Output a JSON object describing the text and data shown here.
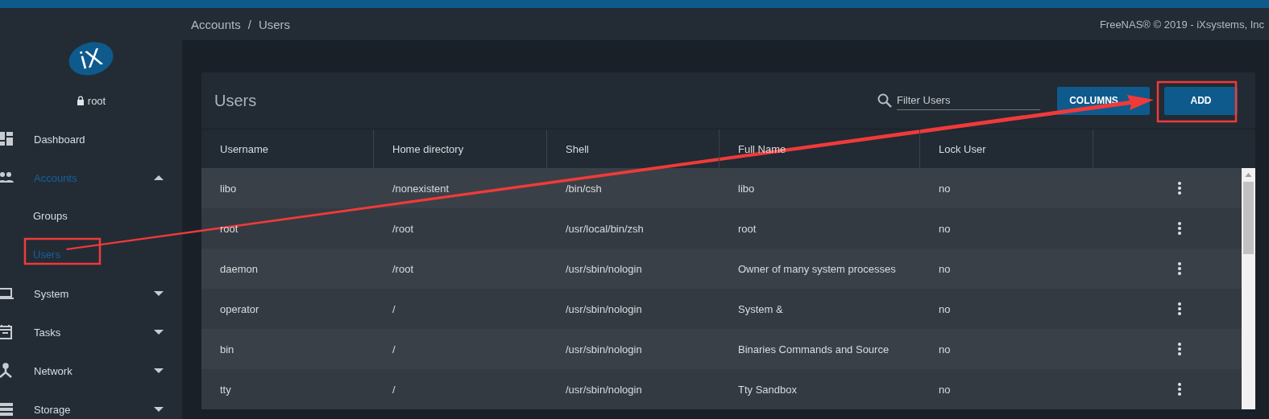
{
  "logo": {
    "text": "iX"
  },
  "user": {
    "name": "root"
  },
  "sidebar": {
    "items": [
      {
        "label": "Dashboard",
        "selected": false
      },
      {
        "label": "Accounts",
        "selected": true,
        "expanded": true,
        "children": [
          {
            "label": "Groups",
            "selected": false
          },
          {
            "label": "Users",
            "selected": true
          }
        ]
      },
      {
        "label": "System",
        "selected": false,
        "expanded": false
      },
      {
        "label": "Tasks",
        "selected": false,
        "expanded": false
      },
      {
        "label": "Network",
        "selected": false,
        "expanded": false
      },
      {
        "label": "Storage",
        "selected": false,
        "expanded": false
      }
    ]
  },
  "breadcrumb": {
    "items": [
      "Accounts",
      "Users"
    ],
    "separator": "/"
  },
  "copyright": "FreeNAS® © 2019 - iXsystems, Inc",
  "card": {
    "title": "Users",
    "filter": {
      "placeholder": "Filter Users"
    },
    "buttons": [
      {
        "label": "COLUMNS",
        "kind": "dropdown"
      },
      {
        "label": "ADD",
        "kind": "plain"
      }
    ]
  },
  "table": {
    "columns": [
      "Username",
      "Home directory",
      "Shell",
      "Full Name",
      "Lock User"
    ],
    "rows": [
      {
        "cells": [
          "libo",
          "/nonexistent",
          "/bin/csh",
          "libo",
          "no"
        ]
      },
      {
        "cells": [
          "root",
          "/root",
          "/usr/local/bin/zsh",
          "root",
          "no"
        ]
      },
      {
        "cells": [
          "daemon",
          "/root",
          "/usr/sbin/nologin",
          "Owner of many system processes",
          "no"
        ]
      },
      {
        "cells": [
          "operator",
          "/",
          "/usr/sbin/nologin",
          "System &",
          "no"
        ]
      },
      {
        "cells": [
          "bin",
          "/",
          "/usr/sbin/nologin",
          "Binaries Commands and Source",
          "no"
        ]
      },
      {
        "cells": [
          "tty",
          "/",
          "/usr/sbin/nologin",
          "Tty Sandbox",
          "no"
        ]
      }
    ]
  }
}
